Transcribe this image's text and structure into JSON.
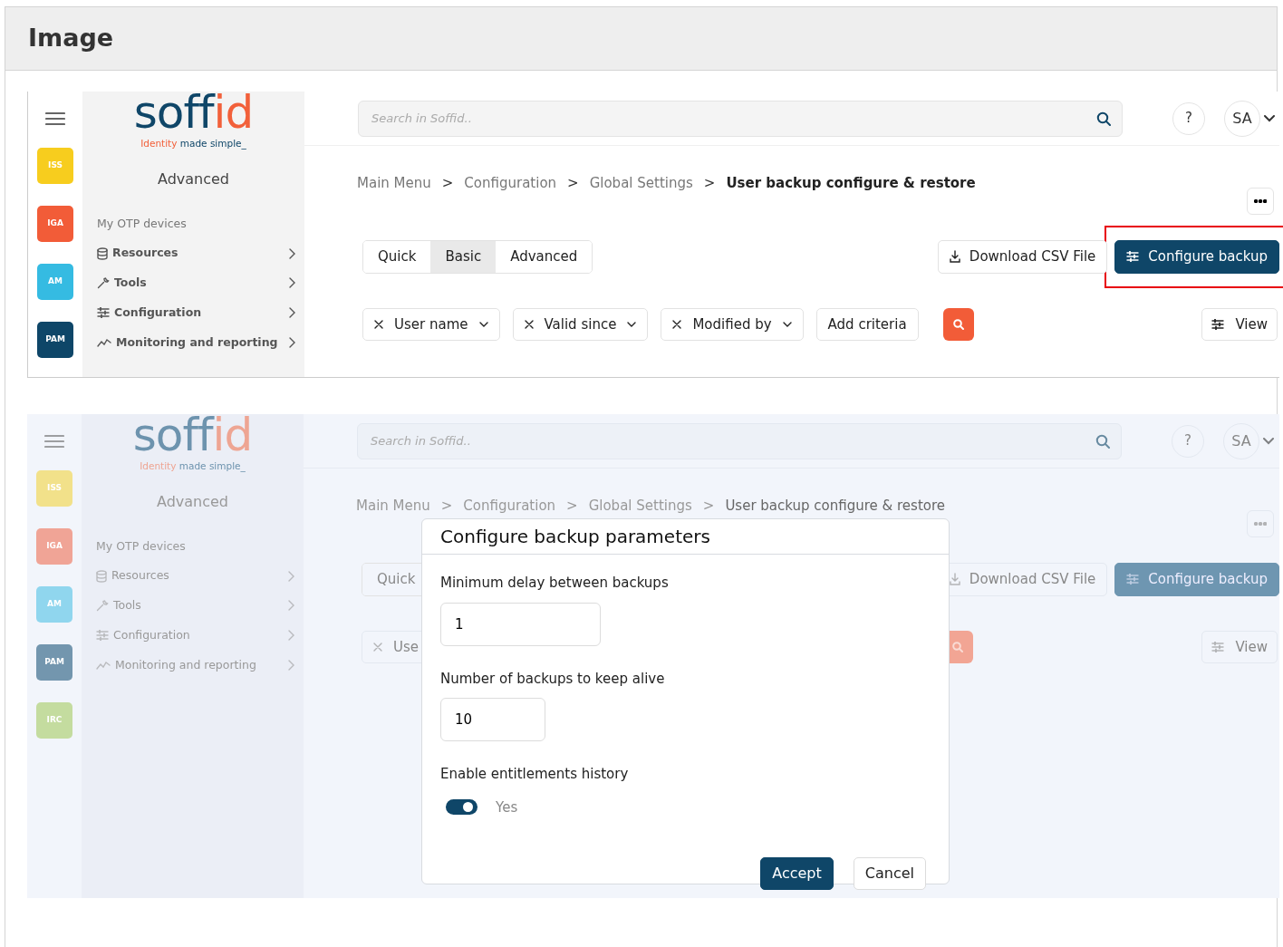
{
  "page_heading": "Image",
  "screenshots": [
    {
      "dimmed": false,
      "apps": [
        {
          "label": "ISS",
          "color": "#f7cd1e"
        },
        {
          "label": "IGA",
          "color": "#f25c38"
        },
        {
          "label": "AM",
          "color": "#35bbe2"
        },
        {
          "label": "PAM",
          "color": "#0e4668"
        }
      ],
      "logo": {
        "name_main": "soff",
        "name_accent": "id",
        "tagline_accent": "Identity",
        "tagline_main": "made simple_"
      },
      "section_title": "Advanced",
      "menu": [
        {
          "label": "My OTP devices",
          "kind": "plain",
          "expandable": false
        },
        {
          "label": "Resources",
          "kind": "database",
          "expandable": true
        },
        {
          "label": "Tools",
          "kind": "wrench",
          "expandable": true
        },
        {
          "label": "Configuration",
          "kind": "sliders",
          "expandable": true
        },
        {
          "label": "Monitoring and reporting",
          "kind": "chart",
          "expandable": true
        }
      ],
      "search_placeholder": "Search in Soffid..",
      "help": "?",
      "user": "SA",
      "breadcrumb": [
        {
          "label": "Main Menu",
          "selected": false
        },
        {
          "separator": ">",
          "label": "Configuration",
          "selected": false
        },
        {
          "separator": ">",
          "label": "Global Settings",
          "selected": false
        },
        {
          "separator": ">",
          "label": "User backup configure & restore",
          "selected": true
        }
      ],
      "search_modes": [
        {
          "label": "Quick",
          "selected": false
        },
        {
          "label": "Basic",
          "selected": true
        },
        {
          "label": "Advanced",
          "selected": false
        }
      ],
      "actions": [
        {
          "label": "Download CSV File",
          "kind": "download",
          "highlighted": false
        },
        {
          "label": "Configure backup",
          "kind": "primary",
          "highlighted": true
        }
      ],
      "criteria": [
        {
          "label": "User name",
          "dropdown": true
        },
        {
          "label": "Valid since",
          "dropdown": true
        },
        {
          "label": "Modified by",
          "dropdown": true
        }
      ],
      "add_criteria": "Add criteria",
      "view": "View"
    },
    {
      "dimmed": true,
      "apps": [
        {
          "label": "ISS",
          "color": "#f2e18a"
        },
        {
          "label": "IGA",
          "color": "#f0a496"
        },
        {
          "label": "AM",
          "color": "#90d6ee"
        },
        {
          "label": "PAM",
          "color": "#7396ae"
        },
        {
          "label": "IRC",
          "color": "#c4dc9f"
        }
      ],
      "logo": {
        "name_main": "soff",
        "name_accent": "id",
        "tagline_accent": "Identity",
        "tagline_main": "made simple_"
      },
      "section_title": "Advanced",
      "menu": [
        {
          "label": "My OTP devices",
          "kind": "plain",
          "expandable": false
        },
        {
          "label": "Resources",
          "kind": "database",
          "expandable": true
        },
        {
          "label": "Tools",
          "kind": "wrench",
          "expandable": true
        },
        {
          "label": "Configuration",
          "kind": "sliders",
          "expandable": true
        },
        {
          "label": "Monitoring and reporting",
          "kind": "chart",
          "expandable": true
        }
      ],
      "search_placeholder": "Search in Soffid..",
      "help": "?",
      "user": "SA",
      "breadcrumb": [
        {
          "label": "Main Menu",
          "selected": false
        },
        {
          "separator": ">",
          "label": "Configuration",
          "selected": false
        },
        {
          "separator": ">",
          "label": "Global Settings",
          "selected": false
        },
        {
          "separator": ">",
          "label": "User backup configure & restore",
          "selected": true
        }
      ],
      "search_modes": [
        {
          "label": "Quick",
          "selected": false
        }
      ],
      "actions": [
        {
          "label": "Download CSV File",
          "kind": "download",
          "highlighted": false
        },
        {
          "label": "Configure backup",
          "kind": "primary",
          "highlighted": false
        }
      ],
      "criteria": [
        {
          "label": "Use",
          "dropdown": false
        }
      ],
      "view": "View",
      "modal": {
        "title": "Configure backup parameters",
        "fields": [
          {
            "label": "Minimum delay between backups",
            "value": "1"
          },
          {
            "label": "Number of backups to keep alive",
            "value": "10"
          }
        ],
        "toggle": {
          "label": "Enable entitlements history",
          "on": true,
          "text": "Yes"
        },
        "buttons": [
          {
            "label": "Accept",
            "kind": "primary"
          },
          {
            "label": "Cancel",
            "kind": "secondary"
          }
        ]
      }
    }
  ]
}
